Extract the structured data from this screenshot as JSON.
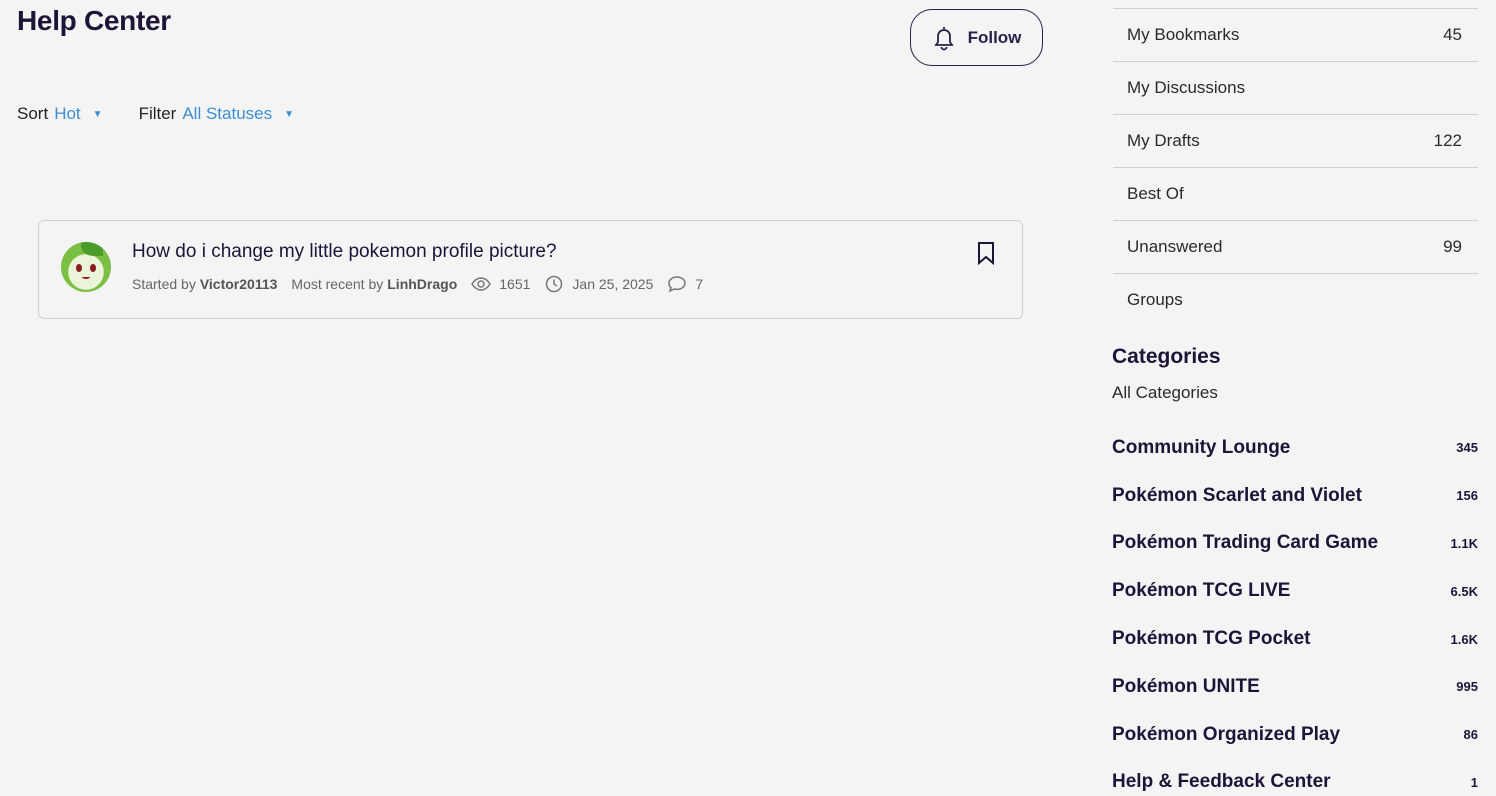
{
  "header": {
    "title": "Help Center",
    "follow_label": "Follow"
  },
  "filters": {
    "sort_label": "Sort",
    "sort_value": "Hot",
    "filter_label": "Filter",
    "filter_value": "All Statuses"
  },
  "discussion": {
    "title": "How do i change my little pokemon profile picture?",
    "started_by_label": "Started by",
    "started_by": "Victor20113",
    "recent_label": "Most recent by",
    "recent_by": "LinhDrago",
    "views": "1651",
    "date": "Jan 25, 2025",
    "comments": "7"
  },
  "sidebar": {
    "items": [
      {
        "label": "My Bookmarks",
        "count": "45"
      },
      {
        "label": "My Discussions",
        "count": ""
      },
      {
        "label": "My Drafts",
        "count": "122"
      },
      {
        "label": "Best Of",
        "count": ""
      },
      {
        "label": "Unanswered",
        "count": "99"
      },
      {
        "label": "Groups",
        "count": ""
      }
    ]
  },
  "categories": {
    "title": "Categories",
    "all_label": "All Categories",
    "items": [
      {
        "name": "Community Lounge",
        "count": "345"
      },
      {
        "name": "Pokémon Scarlet and Violet",
        "count": "156"
      },
      {
        "name": "Pokémon Trading Card Game",
        "count": "1.1K"
      },
      {
        "name": "Pokémon TCG LIVE",
        "count": "6.5K"
      },
      {
        "name": "Pokémon TCG Pocket",
        "count": "1.6K"
      },
      {
        "name": "Pokémon UNITE",
        "count": "995"
      },
      {
        "name": "Pokémon Organized Play",
        "count": "86"
      },
      {
        "name": "Help & Feedback Center",
        "count": "1"
      }
    ]
  },
  "colors": {
    "background": "#f4f4f4",
    "heading": "#1e1438",
    "link_accent": "#3b8fd1"
  }
}
